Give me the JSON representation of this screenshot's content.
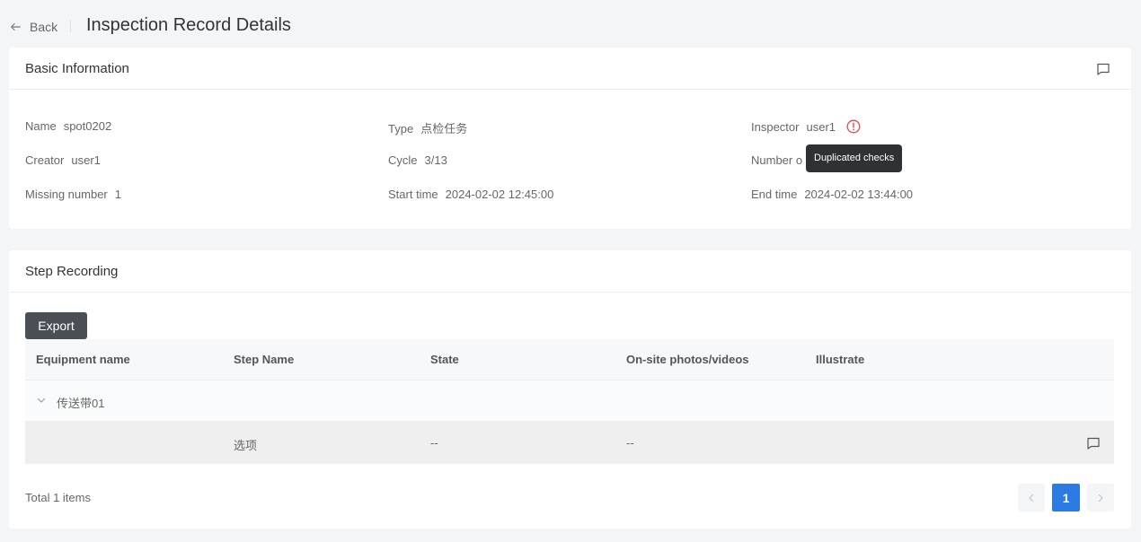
{
  "header": {
    "back_label": "Back",
    "title": "Inspection Record Details",
    "back_icon": "arrow-left-icon"
  },
  "basic_info": {
    "title": "Basic Information",
    "comment_icon": "comment-icon",
    "name_label": "Name",
    "name_value": "spot0202",
    "type_label": "Type",
    "type_value": "点检任务",
    "inspector_label": "Inspector",
    "inspector_value": "user1",
    "warning_icon": "warning-circle-icon",
    "warning_color": "#e5484d",
    "tooltip": "Duplicated checks",
    "creator_label": "Creator",
    "creator_value": "user1",
    "cycle_label": "Cycle",
    "cycle_value": "3/13",
    "number_label_visible": "Number o",
    "missing_label": "Missing number",
    "missing_value": "1",
    "start_label": "Start time",
    "start_value": "2024-02-02 12:45:00",
    "end_label": "End time",
    "end_value": "2024-02-02 13:44:00"
  },
  "steps": {
    "title": "Step Recording",
    "export_label": "Export",
    "columns": [
      "Equipment name",
      "Step Name",
      "State",
      "On-site photos/videos",
      "Illustrate"
    ],
    "group_label": "传送带01",
    "expand_icon": "chevron-down-icon",
    "row": {
      "step_name": "选项",
      "state": "--",
      "media": "--",
      "comment_icon": "comment-icon"
    },
    "total_label": "Total 1 items",
    "current_page": "1",
    "prev_icon": "chevron-left-icon",
    "next_icon": "chevron-right-icon",
    "accent": "#2c7be5"
  }
}
